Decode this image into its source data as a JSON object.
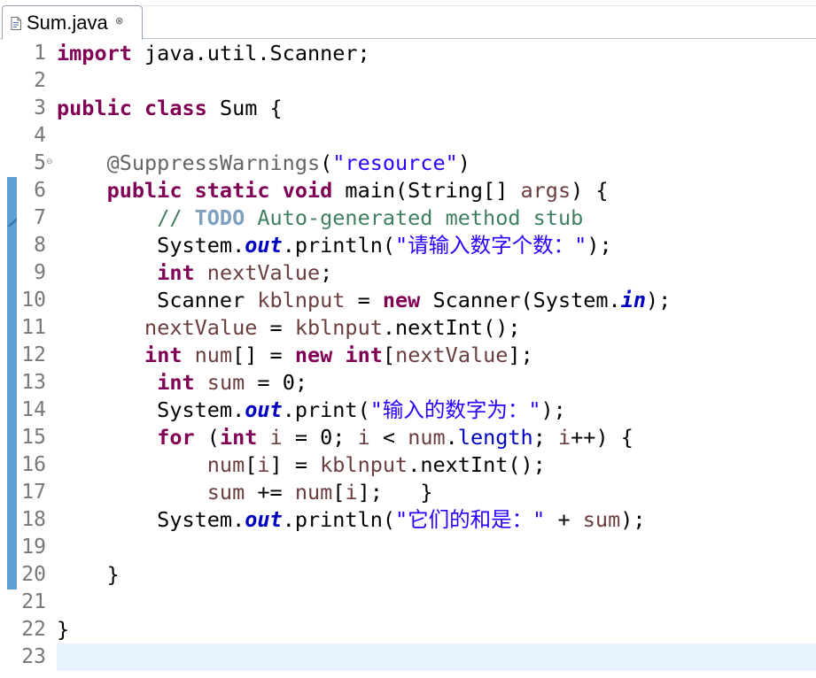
{
  "tab": {
    "title": "Sum.java",
    "icon": "java-file-icon",
    "close_glyph": "⊗"
  },
  "colors": {
    "keyword": "#7f0055",
    "string": "#2a00ff",
    "comment": "#3f7f5f",
    "task_tag": "#7f9fbf",
    "annotation": "#646464",
    "static_field": "#0000c0",
    "line_number": "#787878",
    "current_line": "#e8f2fe",
    "quick_diff": "#5f9fd1"
  },
  "editor": {
    "current_line": 23,
    "lines": [
      {
        "n": "1",
        "fold": "",
        "tokens": [
          {
            "t": "import",
            "c": "kw"
          },
          {
            "t": " java.util.Scanner;",
            "c": ""
          }
        ]
      },
      {
        "n": "2",
        "fold": "",
        "tokens": []
      },
      {
        "n": "3",
        "fold": "",
        "tokens": [
          {
            "t": "public",
            "c": "kw"
          },
          {
            "t": " ",
            "c": ""
          },
          {
            "t": "class",
            "c": "kw"
          },
          {
            "t": " Sum {",
            "c": ""
          }
        ]
      },
      {
        "n": "4",
        "fold": "",
        "tokens": []
      },
      {
        "n": "5",
        "fold": "⊖",
        "tokens": [
          {
            "t": "    ",
            "c": ""
          },
          {
            "t": "@SuppressWarnings",
            "c": "ann"
          },
          {
            "t": "(",
            "c": ""
          },
          {
            "t": "\"resource\"",
            "c": "str"
          },
          {
            "t": ")",
            "c": ""
          }
        ]
      },
      {
        "n": "6",
        "fold": "",
        "tokens": [
          {
            "t": "    ",
            "c": ""
          },
          {
            "t": "public",
            "c": "kw"
          },
          {
            "t": " ",
            "c": ""
          },
          {
            "t": "static",
            "c": "kw"
          },
          {
            "t": " ",
            "c": ""
          },
          {
            "t": "void",
            "c": "kw"
          },
          {
            "t": " main(String[] ",
            "c": ""
          },
          {
            "t": "args",
            "c": "var"
          },
          {
            "t": ") {",
            "c": ""
          }
        ]
      },
      {
        "n": "7",
        "fold": "",
        "tokens": [
          {
            "t": "        ",
            "c": ""
          },
          {
            "t": "// ",
            "c": "cmt"
          },
          {
            "t": "TODO",
            "c": "todo"
          },
          {
            "t": " Auto-generated method stub",
            "c": "cmt"
          }
        ]
      },
      {
        "n": "8",
        "fold": "",
        "tokens": [
          {
            "t": "        System.",
            "c": ""
          },
          {
            "t": "out",
            "c": "fld"
          },
          {
            "t": ".println(",
            "c": ""
          },
          {
            "t": "\"请输入数字个数：\"",
            "c": "str"
          },
          {
            "t": ");",
            "c": ""
          }
        ]
      },
      {
        "n": "9",
        "fold": "",
        "tokens": [
          {
            "t": "        ",
            "c": ""
          },
          {
            "t": "int",
            "c": "kw"
          },
          {
            "t": " ",
            "c": ""
          },
          {
            "t": "nextValue",
            "c": "var"
          },
          {
            "t": ";",
            "c": ""
          }
        ]
      },
      {
        "n": "10",
        "fold": "",
        "tokens": [
          {
            "t": "        Scanner ",
            "c": ""
          },
          {
            "t": "kblnput",
            "c": "var"
          },
          {
            "t": " = ",
            "c": ""
          },
          {
            "t": "new",
            "c": "kw"
          },
          {
            "t": " Scanner(System.",
            "c": ""
          },
          {
            "t": "in",
            "c": "fld"
          },
          {
            "t": ");",
            "c": ""
          }
        ]
      },
      {
        "n": "11",
        "fold": "",
        "tokens": [
          {
            "t": "       ",
            "c": ""
          },
          {
            "t": "nextValue",
            "c": "var"
          },
          {
            "t": " = ",
            "c": ""
          },
          {
            "t": "kblnput",
            "c": "var"
          },
          {
            "t": ".nextInt();",
            "c": ""
          }
        ]
      },
      {
        "n": "12",
        "fold": "",
        "tokens": [
          {
            "t": "       ",
            "c": ""
          },
          {
            "t": "int",
            "c": "kw"
          },
          {
            "t": " ",
            "c": ""
          },
          {
            "t": "num",
            "c": "var"
          },
          {
            "t": "[] = ",
            "c": ""
          },
          {
            "t": "new",
            "c": "kw"
          },
          {
            "t": " ",
            "c": ""
          },
          {
            "t": "int",
            "c": "kw"
          },
          {
            "t": "[",
            "c": ""
          },
          {
            "t": "nextValue",
            "c": "var"
          },
          {
            "t": "];",
            "c": ""
          }
        ]
      },
      {
        "n": "13",
        "fold": "",
        "tokens": [
          {
            "t": "        ",
            "c": ""
          },
          {
            "t": "int",
            "c": "kw"
          },
          {
            "t": " ",
            "c": ""
          },
          {
            "t": "sum",
            "c": "var"
          },
          {
            "t": " = 0;",
            "c": ""
          }
        ]
      },
      {
        "n": "14",
        "fold": "",
        "tokens": [
          {
            "t": "        System.",
            "c": ""
          },
          {
            "t": "out",
            "c": "fld"
          },
          {
            "t": ".print(",
            "c": ""
          },
          {
            "t": "\"输入的数字为：\"",
            "c": "str"
          },
          {
            "t": ");",
            "c": ""
          }
        ]
      },
      {
        "n": "15",
        "fold": "",
        "tokens": [
          {
            "t": "        ",
            "c": ""
          },
          {
            "t": "for",
            "c": "kw"
          },
          {
            "t": " (",
            "c": ""
          },
          {
            "t": "int",
            "c": "kw"
          },
          {
            "t": " ",
            "c": ""
          },
          {
            "t": "i",
            "c": "var"
          },
          {
            "t": " = 0; ",
            "c": ""
          },
          {
            "t": "i",
            "c": "var"
          },
          {
            "t": " < ",
            "c": ""
          },
          {
            "t": "num",
            "c": "var"
          },
          {
            "t": ".",
            "c": ""
          },
          {
            "t": "length",
            "c": "len"
          },
          {
            "t": "; ",
            "c": ""
          },
          {
            "t": "i",
            "c": "var"
          },
          {
            "t": "++) {",
            "c": ""
          }
        ]
      },
      {
        "n": "16",
        "fold": "",
        "tokens": [
          {
            "t": "            ",
            "c": ""
          },
          {
            "t": "num",
            "c": "var"
          },
          {
            "t": "[",
            "c": ""
          },
          {
            "t": "i",
            "c": "var"
          },
          {
            "t": "] = ",
            "c": ""
          },
          {
            "t": "kblnput",
            "c": "var"
          },
          {
            "t": ".nextInt();",
            "c": ""
          }
        ]
      },
      {
        "n": "17",
        "fold": "",
        "tokens": [
          {
            "t": "            ",
            "c": ""
          },
          {
            "t": "sum",
            "c": "var"
          },
          {
            "t": " += ",
            "c": ""
          },
          {
            "t": "num",
            "c": "var"
          },
          {
            "t": "[",
            "c": ""
          },
          {
            "t": "i",
            "c": "var"
          },
          {
            "t": "];   }",
            "c": ""
          }
        ]
      },
      {
        "n": "18",
        "fold": "",
        "tokens": [
          {
            "t": "        System.",
            "c": ""
          },
          {
            "t": "out",
            "c": "fld"
          },
          {
            "t": ".println(",
            "c": ""
          },
          {
            "t": "\"它们的和是：\"",
            "c": "str"
          },
          {
            "t": " + ",
            "c": ""
          },
          {
            "t": "sum",
            "c": "var"
          },
          {
            "t": ");",
            "c": ""
          }
        ]
      },
      {
        "n": "19",
        "fold": "",
        "tokens": []
      },
      {
        "n": "20",
        "fold": "",
        "tokens": [
          {
            "t": "    }",
            "c": ""
          }
        ]
      },
      {
        "n": "21",
        "fold": "",
        "tokens": []
      },
      {
        "n": "22",
        "fold": "",
        "tokens": [
          {
            "t": "}",
            "c": ""
          }
        ]
      },
      {
        "n": "23",
        "fold": "",
        "tokens": []
      }
    ]
  }
}
